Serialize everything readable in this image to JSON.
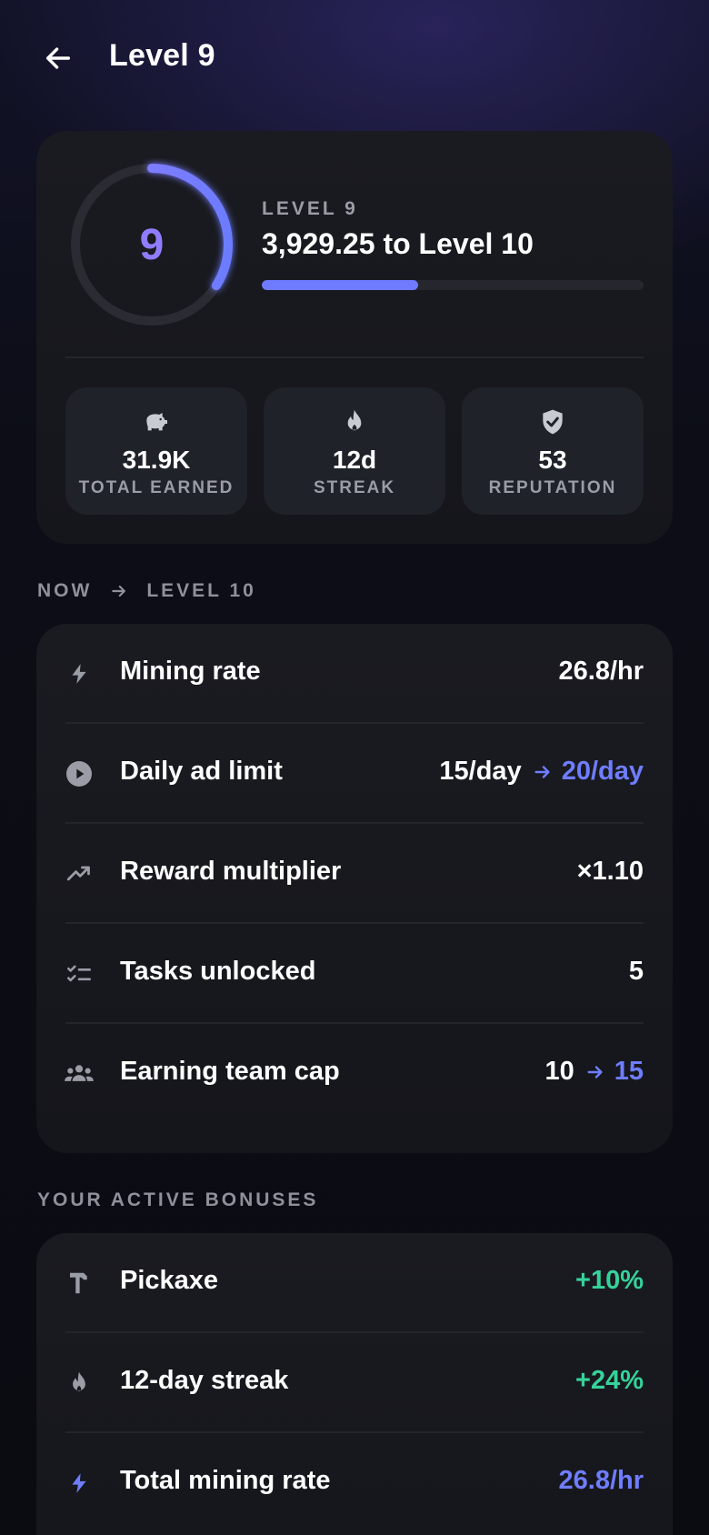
{
  "header": {
    "title": "Level 9"
  },
  "level": {
    "number": "9",
    "label": "LEVEL 9",
    "progress_text": "3,929.25 to Level 10",
    "progress_fraction": 0.41,
    "ring_fraction": 0.34
  },
  "stats": [
    {
      "icon": "piggy-bank-icon",
      "value": "31.9K",
      "label": "TOTAL EARNED"
    },
    {
      "icon": "flame-icon",
      "value": "12d",
      "label": "STREAK"
    },
    {
      "icon": "shield-check-icon",
      "value": "53",
      "label": "REPUTATION"
    }
  ],
  "compare": {
    "from_label": "NOW",
    "to_label": "LEVEL 10",
    "rows": [
      {
        "icon": "bolt-icon",
        "label": "Mining rate",
        "value": "26.8/hr",
        "next": ""
      },
      {
        "icon": "play-circle-icon",
        "label": "Daily ad limit",
        "value": "15/day",
        "next": "20/day"
      },
      {
        "icon": "trend-up-icon",
        "label": "Reward multiplier",
        "value": "×1.10",
        "next": ""
      },
      {
        "icon": "checklist-icon",
        "label": "Tasks unlocked",
        "value": "5",
        "next": ""
      },
      {
        "icon": "group-icon",
        "label": "Earning team cap",
        "value": "10",
        "next": "15"
      }
    ]
  },
  "bonuses": {
    "title": "YOUR ACTIVE BONUSES",
    "rows": [
      {
        "icon": "pickaxe-icon",
        "label": "Pickaxe",
        "value": "+10%"
      },
      {
        "icon": "flame-icon",
        "label": "12-day streak",
        "value": "+24%"
      },
      {
        "icon": "bolt-icon",
        "label": "Total mining rate",
        "value": "26.8/hr"
      }
    ]
  },
  "colors": {
    "accent": "#6f7bff",
    "ring_accent": "#8f7dff",
    "positive": "#35d39a",
    "card": "#17181d",
    "muted": "#9a9ca6"
  }
}
